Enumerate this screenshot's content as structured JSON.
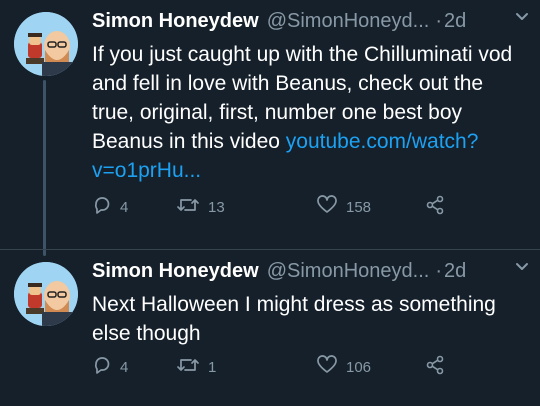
{
  "colors": {
    "background": "#15202b",
    "text": "#ffffff",
    "muted": "#8899a6",
    "link": "#1da1f2"
  },
  "tweets": [
    {
      "name": "Simon Honeydew",
      "handle": "@SimonHoneyd...",
      "separator": "·",
      "time": "2d",
      "text_before_link": "If you just caught up with the Chilluminati vod and fell in love with Beanus, check out the true, original, first, number one best boy Beanus in this video ",
      "link_line1": "youtube.com/watch?",
      "link_line2": "v=o1prHu...",
      "replies": "4",
      "retweets": "13",
      "likes": "158"
    },
    {
      "name": "Simon Honeydew",
      "handle": "@SimonHoneyd...",
      "separator": "·",
      "time": "2d",
      "text": "Next Halloween I might dress as something else though",
      "replies": "4",
      "retweets": "1",
      "likes": "106"
    }
  ],
  "icons": {
    "reply": "reply-icon",
    "retweet": "retweet-icon",
    "like": "heart-icon",
    "share": "share-icon",
    "more": "chevron-down-icon"
  }
}
